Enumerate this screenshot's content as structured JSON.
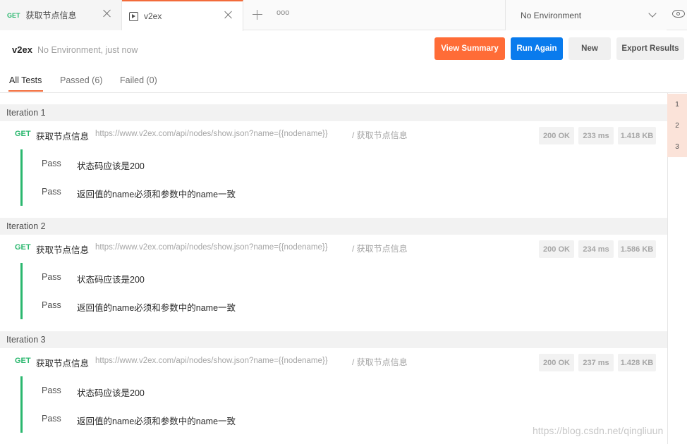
{
  "tabs": [
    {
      "method": "GET",
      "label": "获取节点信息"
    },
    {
      "label": "v2ex"
    }
  ],
  "environment": {
    "selected": "No Environment"
  },
  "header": {
    "title": "v2ex",
    "subtitle": "No Environment, just now",
    "buttons": {
      "view_summary": "View Summary",
      "run_again": "Run Again",
      "new": "New",
      "export": "Export Results"
    }
  },
  "filters": {
    "all": "All Tests",
    "passed": "Passed (6)",
    "failed": "Failed (0)"
  },
  "iteration_numbers": [
    "1",
    "2",
    "3"
  ],
  "iterations": [
    {
      "label": "Iteration 1",
      "request": {
        "method": "GET",
        "name": "获取节点信息",
        "url": "https://www.v2ex.com/api/nodes/show.json?name={{nodename}}",
        "path": "/ 获取节点信息",
        "status": "200 OK",
        "time": "233 ms",
        "size": "1.418 KB"
      },
      "tests": [
        {
          "result": "Pass",
          "name": "状态码应该是200"
        },
        {
          "result": "Pass",
          "name": "返回值的name必须和参数中的name一致"
        }
      ]
    },
    {
      "label": "Iteration 2",
      "request": {
        "method": "GET",
        "name": "获取节点信息",
        "url": "https://www.v2ex.com/api/nodes/show.json?name={{nodename}}",
        "path": "/ 获取节点信息",
        "status": "200 OK",
        "time": "234 ms",
        "size": "1.586 KB"
      },
      "tests": [
        {
          "result": "Pass",
          "name": "状态码应该是200"
        },
        {
          "result": "Pass",
          "name": "返回值的name必须和参数中的name一致"
        }
      ]
    },
    {
      "label": "Iteration 3",
      "request": {
        "method": "GET",
        "name": "获取节点信息",
        "url": "https://www.v2ex.com/api/nodes/show.json?name={{nodename}}",
        "path": "/ 获取节点信息",
        "status": "200 OK",
        "time": "237 ms",
        "size": "1.428 KB"
      },
      "tests": [
        {
          "result": "Pass",
          "name": "状态码应该是200"
        },
        {
          "result": "Pass",
          "name": "返回值的name必须和参数中的name一致"
        }
      ]
    }
  ],
  "watermark": "https://blog.csdn.net/qingliuun"
}
